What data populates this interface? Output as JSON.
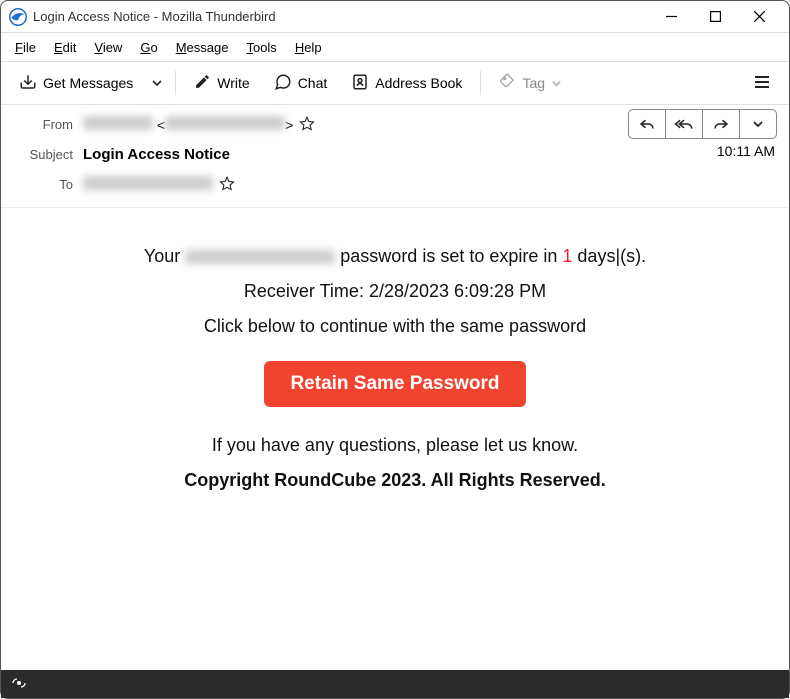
{
  "titlebar": {
    "title": "Login Access Notice - Mozilla Thunderbird"
  },
  "menubar": {
    "file": "File",
    "edit": "Edit",
    "view": "View",
    "go": "Go",
    "message": "Message",
    "tools": "Tools",
    "help": "Help"
  },
  "toolbar": {
    "get_messages": "Get Messages",
    "write": "Write",
    "chat": "Chat",
    "address_book": "Address Book",
    "tag": "Tag"
  },
  "header": {
    "from_label": "From",
    "subject_label": "Subject",
    "to_label": "To",
    "subject_value": "Login Access Notice",
    "time": "10:11 AM"
  },
  "body": {
    "line1_prefix": "Your ",
    "line1_suffix": " password is set to expire in ",
    "days": "1",
    "line1_tail": " days|(s).",
    "receiver_time": "Receiver Time: 2/28/2023 6:09:28 PM",
    "instruction": "Click below to continue with the same password",
    "cta": "Retain Same Password",
    "footer_q": "If you have any questions, please let us know.",
    "copyright": "Copyright RoundCube 2023. All Rights Reserved."
  }
}
